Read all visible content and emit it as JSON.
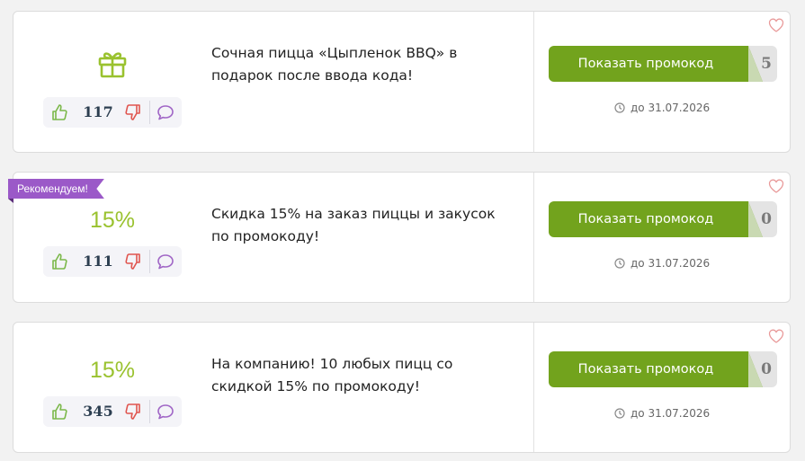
{
  "colors": {
    "accent_green": "#72a31d",
    "discount_green": "#9ac22f",
    "ribbon_purple": "#9b59c8"
  },
  "offers": [
    {
      "icon": "gift-icon",
      "votes": "117",
      "description": "Сочная пицца «Цыпленок BBQ» в подарок после ввода кода!",
      "button_label": "Показать промокод",
      "code_peek": "5",
      "expiry": "до 31.07.2026"
    },
    {
      "badge": "Рекомендуем!",
      "discount": "15%",
      "votes": "111",
      "description": "Скидка 15% на заказ пиццы и закусок по промокоду!",
      "button_label": "Показать промокод",
      "code_peek": "0",
      "expiry": "до 31.07.2026"
    },
    {
      "discount": "15%",
      "votes": "345",
      "description": "На компанию! 10 любых пицц со скидкой 15% по промокоду!",
      "button_label": "Показать промокод",
      "code_peek": "0",
      "expiry": "до 31.07.2026"
    }
  ]
}
